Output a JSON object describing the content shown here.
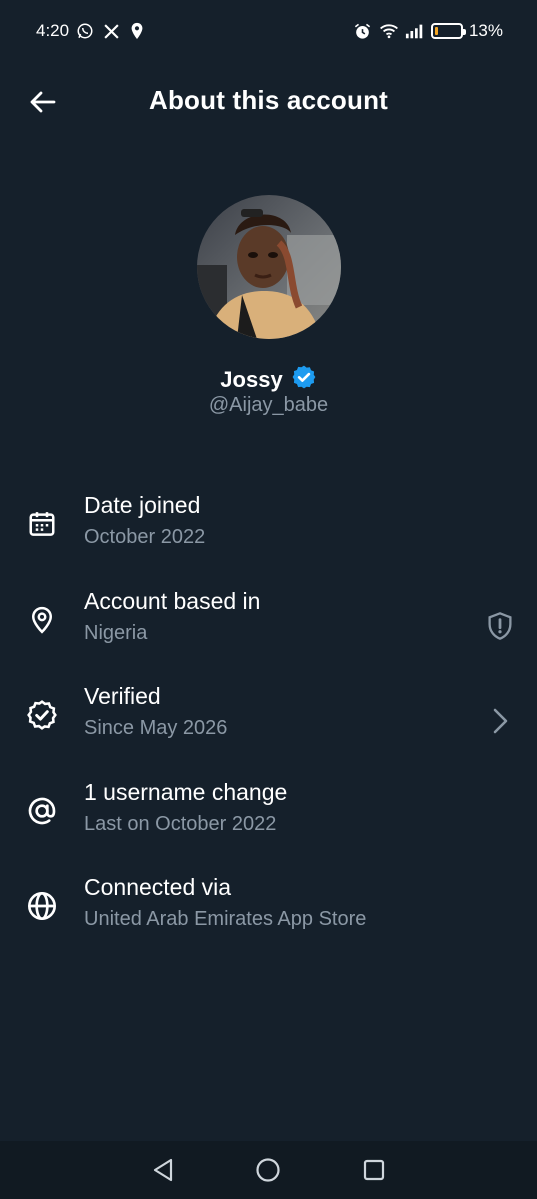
{
  "status_bar": {
    "time": "4:20",
    "battery_percent": "13%",
    "battery_level": 0.13,
    "left_icons": [
      "whatsapp-icon",
      "x-logo-icon",
      "location-icon"
    ],
    "right_icons": [
      "alarm-icon",
      "wifi-icon",
      "signal-icon",
      "battery-icon"
    ]
  },
  "header": {
    "title": "About this account",
    "back_icon": "arrow-left-icon"
  },
  "profile": {
    "name": "Jossy",
    "handle": "@Aijay_babe",
    "verified": true,
    "verified_color": "#1d9bf0"
  },
  "info_items": [
    {
      "icon": "calendar-icon",
      "label": "Date joined",
      "value": "October 2022"
    },
    {
      "icon": "location-pin-icon",
      "label": "Account based in",
      "value": "Nigeria",
      "right_icon": "shield-alert-icon"
    },
    {
      "icon": "verified-badge-icon",
      "label": "Verified",
      "value": "Since May 2026",
      "right_icon": "chevron-right-icon"
    },
    {
      "icon": "at-sign-icon",
      "label": "1 username change",
      "value": "Last on October 2022"
    },
    {
      "icon": "globe-icon",
      "label": "Connected via",
      "value": "United Arab Emirates App Store"
    }
  ],
  "colors": {
    "background": "#15202b",
    "secondary_text": "#8b98a5",
    "accent": "#1d9bf0",
    "battery_low": "#f5a623"
  },
  "nav_bar": {
    "buttons": [
      "back-triangle-icon",
      "home-circle-icon",
      "recents-square-icon"
    ]
  }
}
